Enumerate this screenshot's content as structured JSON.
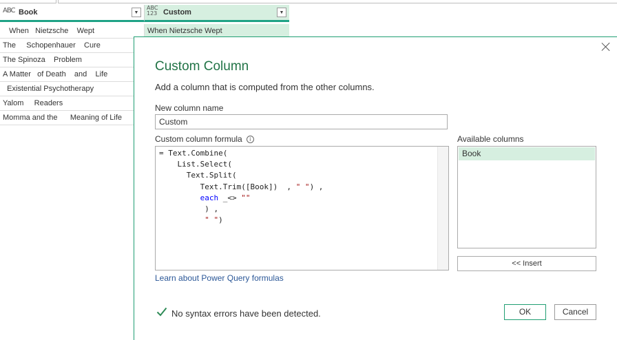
{
  "table": {
    "columns": [
      {
        "type_icon": "text-type-icon",
        "type_label": "ABC",
        "name": "Book"
      },
      {
        "type_icon": "any-type-icon",
        "type_label": "ABC 123",
        "name": "Custom"
      }
    ],
    "book_rows": [
      "   When   Nietzsche    Wept",
      "The     Schopenhauer    Cure",
      "The Spinoza    Problem",
      "A Matter   of Death    and    Life",
      "  Existential Psychotherapy",
      "Yalom     Readers",
      "Momma and the      Meaning of Life"
    ],
    "custom_first_value": "When Nietzsche Wept"
  },
  "dialog": {
    "title": "Custom Column",
    "description": "Add a column that is computed from the other columns.",
    "new_column_label": "New column name",
    "new_column_value": "Custom",
    "formula_label": "Custom column formula",
    "info_glyph": "i",
    "formula_lines": [
      "= Text.Combine(",
      "    List.Select(",
      "      Text.Split(",
      "         Text.Trim([Book])  , \" \") ,",
      "         each _<> \"\"",
      "          ) ,",
      "          \" \")"
    ],
    "available_label": "Available columns",
    "available_columns": [
      "Book"
    ],
    "insert_label": "<< Insert",
    "learn_link": "Learn about Power Query formulas",
    "status": "No syntax errors have been detected.",
    "ok_label": "OK",
    "cancel_label": "Cancel"
  },
  "colors": {
    "accent_green": "#217346",
    "header_bar": "#1fa386",
    "selection_bg": "#d6efe0",
    "link_blue": "#2b5797",
    "keyword_blue": "#0000ff",
    "string_red": "#a31515",
    "check_green": "#2e8b57"
  }
}
